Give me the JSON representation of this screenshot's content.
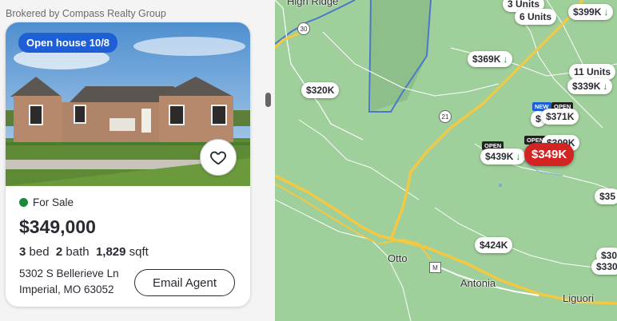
{
  "listing": {
    "broker": "Brokered by Compass Realty Group",
    "badge": "Open house 10/8",
    "status": "For Sale",
    "price": "$349,000",
    "beds": "3",
    "beds_label": "bed",
    "baths": "2",
    "baths_label": "bath",
    "sqft": "1,829",
    "sqft_label": "sqft",
    "address_line1": "5302 S Bellerieve Ln",
    "address_line2": "Imperial, MO 63052",
    "email_button": "Email Agent",
    "status_color": "#1a8a3a",
    "badge_color": "#1f5fd6"
  },
  "map": {
    "active_pin": "$349K",
    "active_color": "#d32323",
    "pins": [
      {
        "label": "3 Units",
        "arrow": ""
      },
      {
        "label": "6 Units",
        "arrow": ""
      },
      {
        "label": "$399K",
        "arrow": "↓"
      },
      {
        "label": "$369K",
        "arrow": "↓"
      },
      {
        "label": "11 Units",
        "arrow": ""
      },
      {
        "label": "$339K",
        "arrow": "↓"
      },
      {
        "label": "$320K",
        "arrow": ""
      },
      {
        "label": "$371K",
        "arrow": ""
      },
      {
        "label": "$309K",
        "arrow": ""
      },
      {
        "label": "$439K",
        "arrow": "↓"
      },
      {
        "label": "$424K",
        "arrow": ""
      },
      {
        "label": "$35",
        "arrow": ""
      },
      {
        "label": "$30",
        "arrow": ""
      },
      {
        "label": "$330",
        "arrow": ""
      },
      {
        "label": "$",
        "arrow": ""
      }
    ],
    "tags": [
      "NEW",
      "OPEN",
      "OPEN",
      "OPEN"
    ],
    "towns": [
      "High Ridge",
      "Otto",
      "Antonia",
      "Liguori"
    ],
    "routes": [
      "30",
      "21",
      "M"
    ]
  }
}
